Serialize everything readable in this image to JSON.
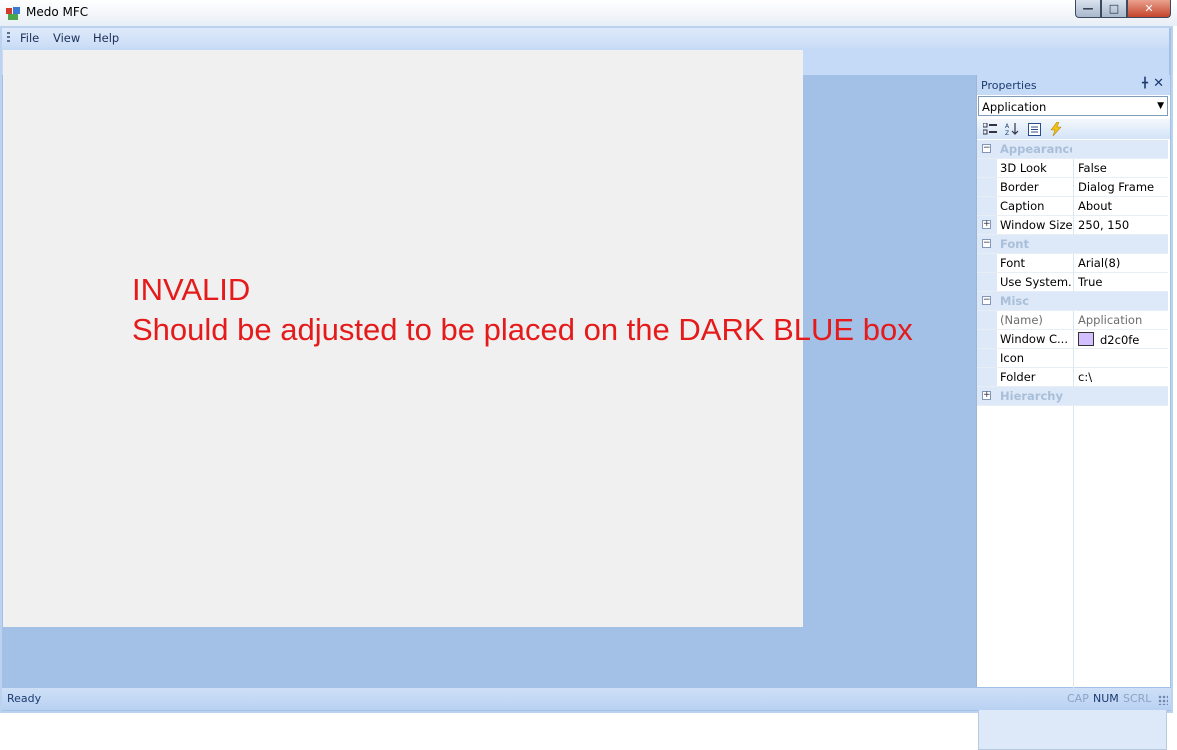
{
  "window": {
    "title": "Medo MFC"
  },
  "menu": [
    {
      "label": "File"
    },
    {
      "label": "View"
    },
    {
      "label": "Help"
    }
  ],
  "annotation": {
    "text": "INVALID\nShould be adjusted to be placed on the DARK BLUE box",
    "color": "#e51a1a"
  },
  "properties": {
    "title": "Properties",
    "selected_object": "Application",
    "categories": [
      {
        "name": "Appearance",
        "rows": [
          {
            "name": "3D Look",
            "value": "False"
          },
          {
            "name": "Border",
            "value": "Dialog Frame"
          },
          {
            "name": "Caption",
            "value": "About"
          },
          {
            "name": "Window Size",
            "value": "250, 150",
            "expandable": true
          }
        ]
      },
      {
        "name": "Font",
        "rows": [
          {
            "name": "Font",
            "value": "Arial(8)"
          },
          {
            "name": "Use System...",
            "value": "True"
          }
        ]
      },
      {
        "name": "Misc",
        "rows": [
          {
            "name": "(Name)",
            "value": "Application",
            "readonly": true
          },
          {
            "name": "Window C...",
            "value": "d2c0fe",
            "swatch": "#d2c0fe"
          },
          {
            "name": "Icon",
            "value": ""
          },
          {
            "name": "Folder",
            "value": "c:\\"
          }
        ]
      },
      {
        "name": "Hierarchy",
        "collapsed": true,
        "rows": []
      }
    ]
  },
  "status": {
    "text": "Ready",
    "indicators": [
      {
        "label": "CAP",
        "active": false
      },
      {
        "label": "NUM",
        "active": true
      },
      {
        "label": "SCRL",
        "active": false
      }
    ]
  },
  "colors": {
    "frame": "#a3c1e6",
    "canvas": "#f0f0f0",
    "toolbar": "#c4daf7"
  }
}
